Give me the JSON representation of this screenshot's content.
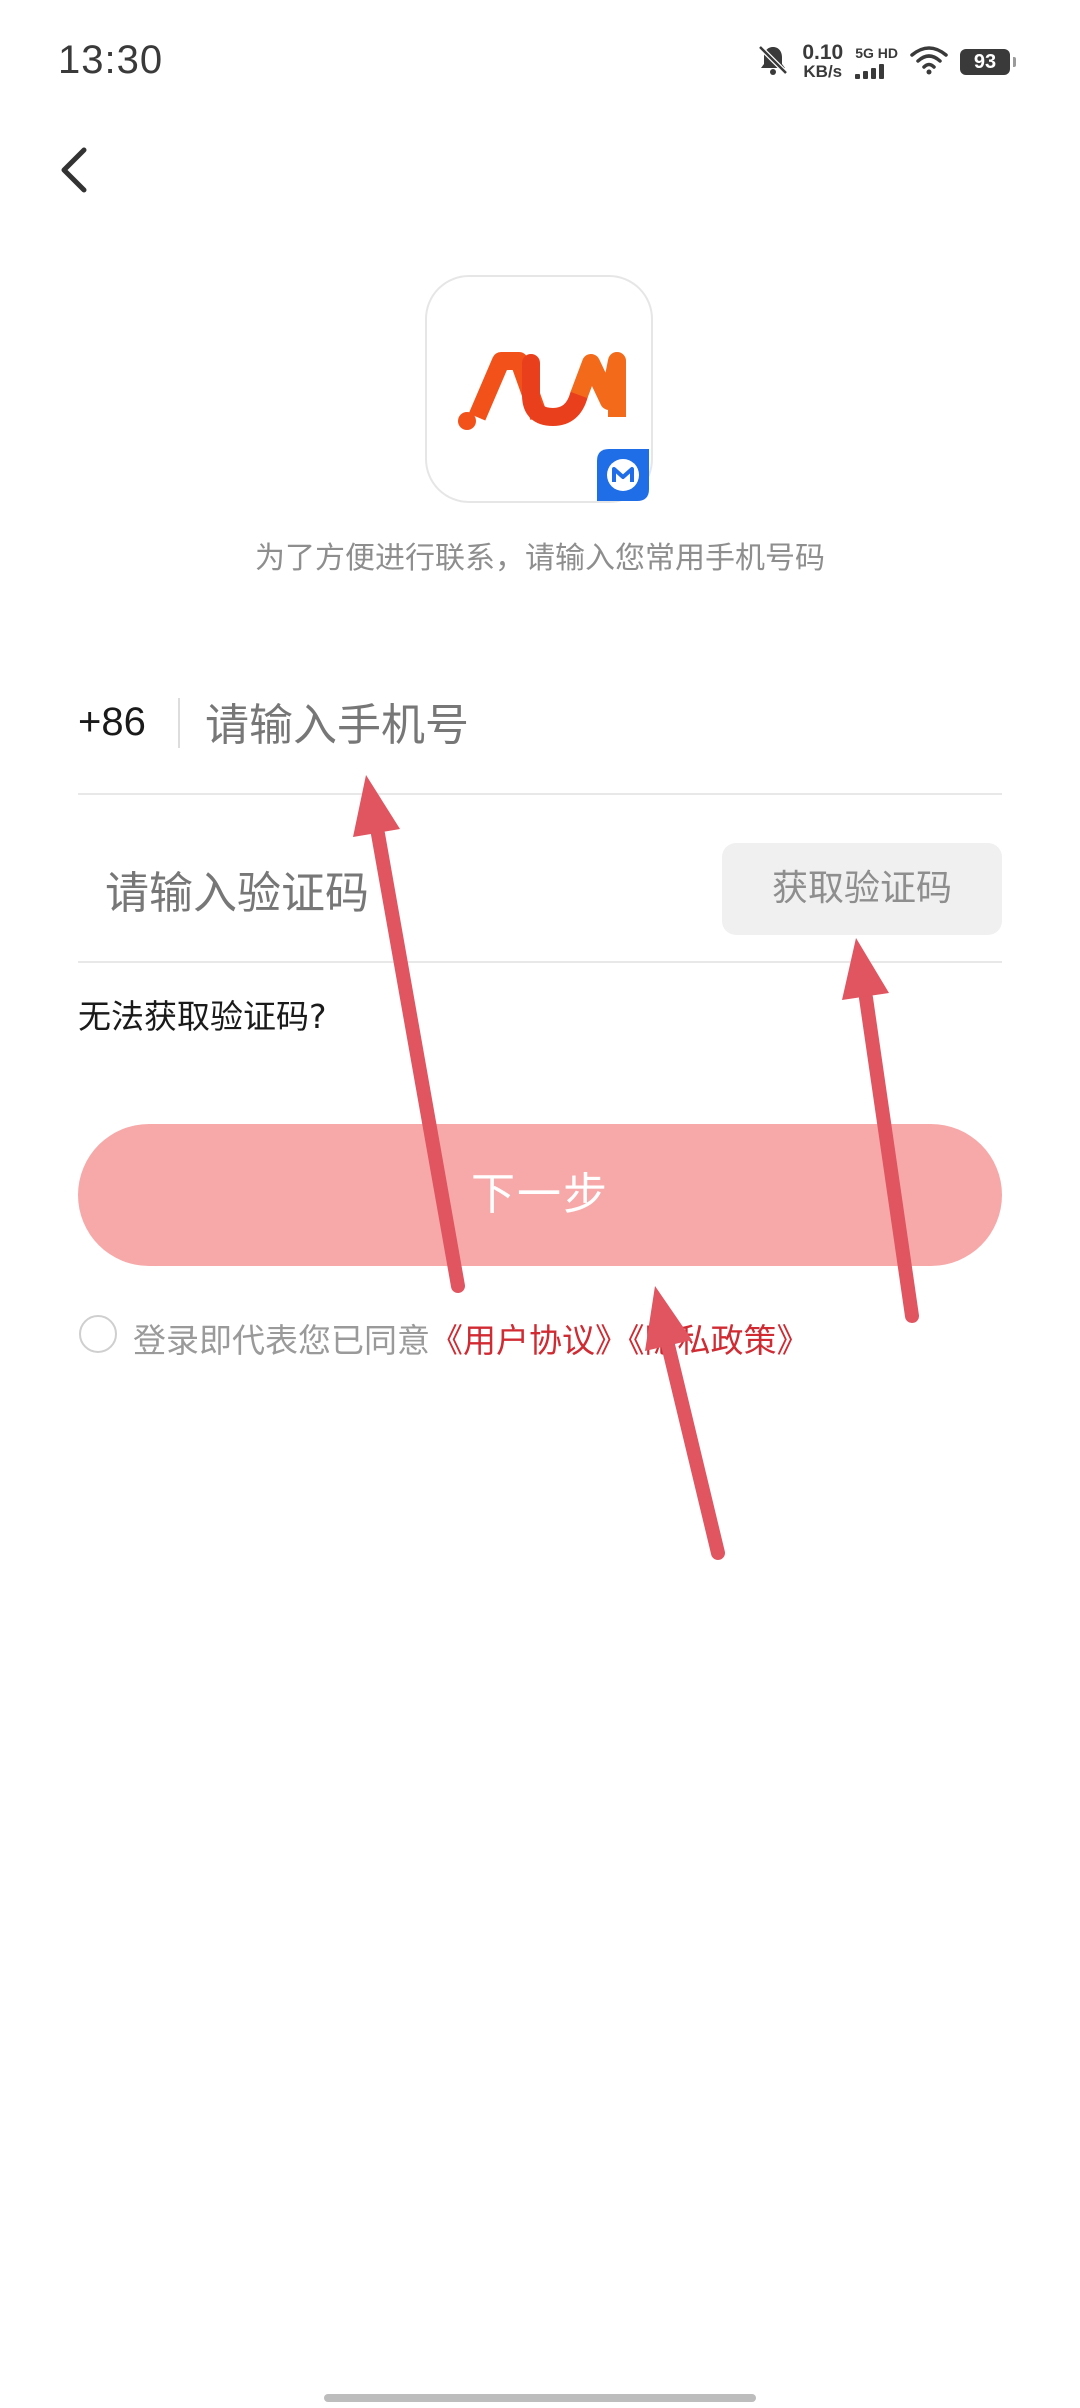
{
  "status_bar": {
    "time": "13:30",
    "speed_value": "0.10",
    "speed_unit": "KB/s",
    "network_type": "5G HD",
    "battery_level": "93",
    "icons": [
      "bell-muted-icon",
      "signal-bars-icon",
      "wifi-icon",
      "battery-icon"
    ]
  },
  "nav": {
    "back_icon": "chevron-left-icon"
  },
  "logo": {
    "brand_text": "AJM",
    "badge_icon": "m-badge-icon"
  },
  "hint_text": "为了方便进行联系，请输入您常用手机号码",
  "phone": {
    "country_code": "+86",
    "placeholder": "请输入手机号",
    "value": ""
  },
  "verification": {
    "placeholder": "请输入验证码",
    "value": "",
    "get_code_label": "获取验证码"
  },
  "cannot_receive_label": "无法获取验证码?",
  "next_button_label": "下一步",
  "agreement": {
    "prefix": "登录即代表您已同意",
    "user_agreement": "《用户协议》",
    "privacy_policy": "《隐私政策》",
    "checked": false
  },
  "colors": {
    "accent_red": "#d02a32",
    "button_pink": "#f7a9a9",
    "arrow_red": "#e05560",
    "logo_orange": "#f2521a"
  }
}
